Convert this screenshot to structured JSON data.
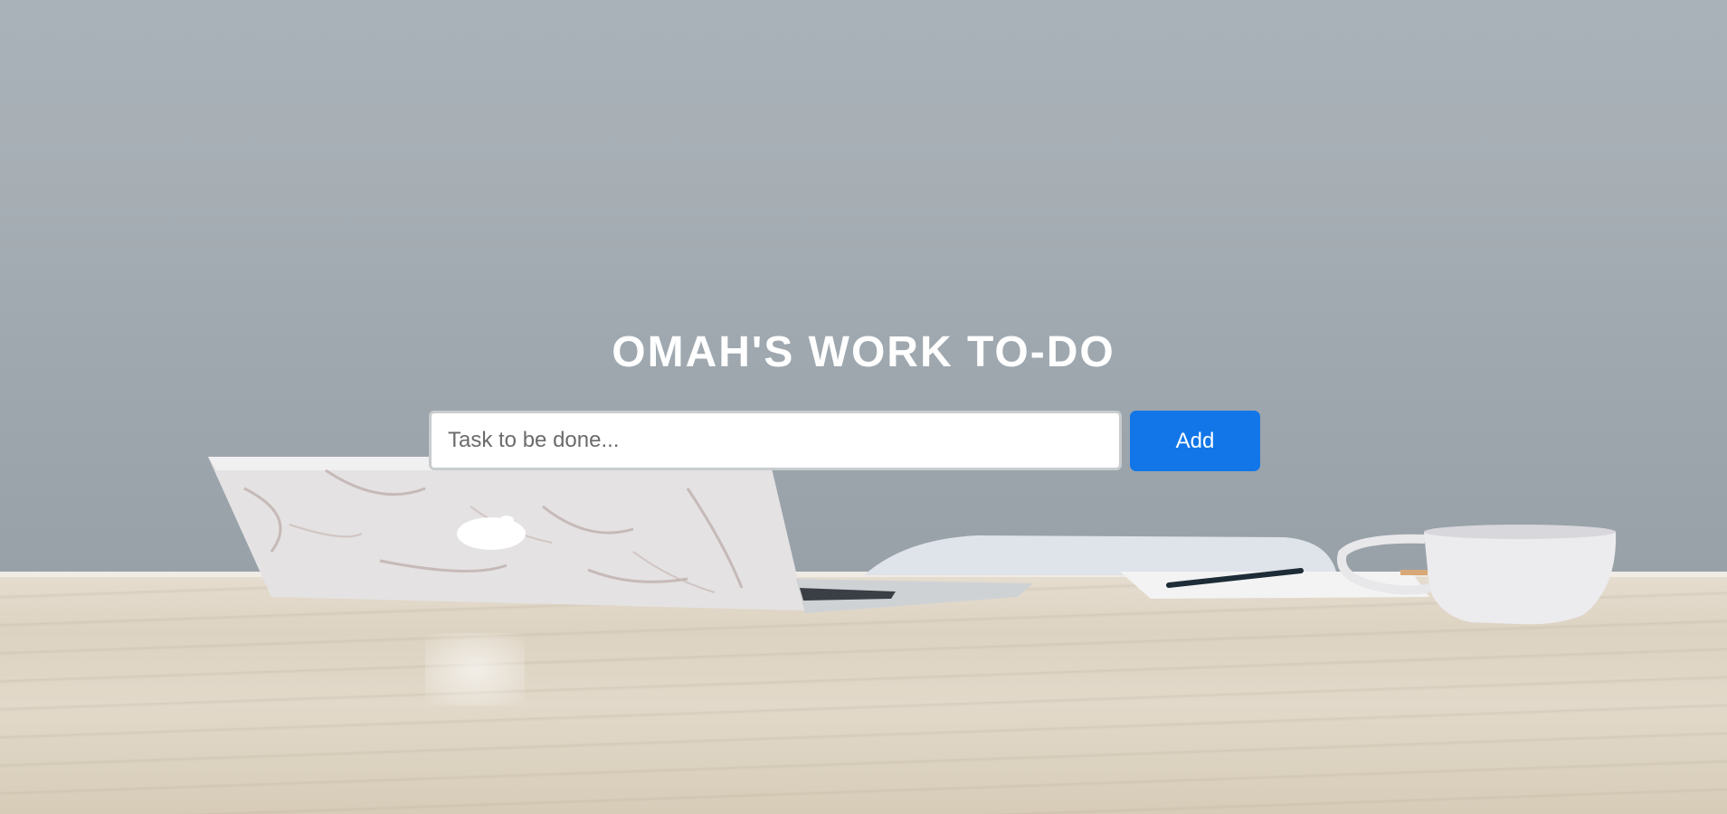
{
  "app": {
    "title": "OMAH'S WORK TO-DO"
  },
  "task_form": {
    "input_placeholder": "Task to be done...",
    "input_value": "",
    "add_label": "Add"
  },
  "colors": {
    "add_button": "#1276e8",
    "title_text": "#ffffff"
  }
}
